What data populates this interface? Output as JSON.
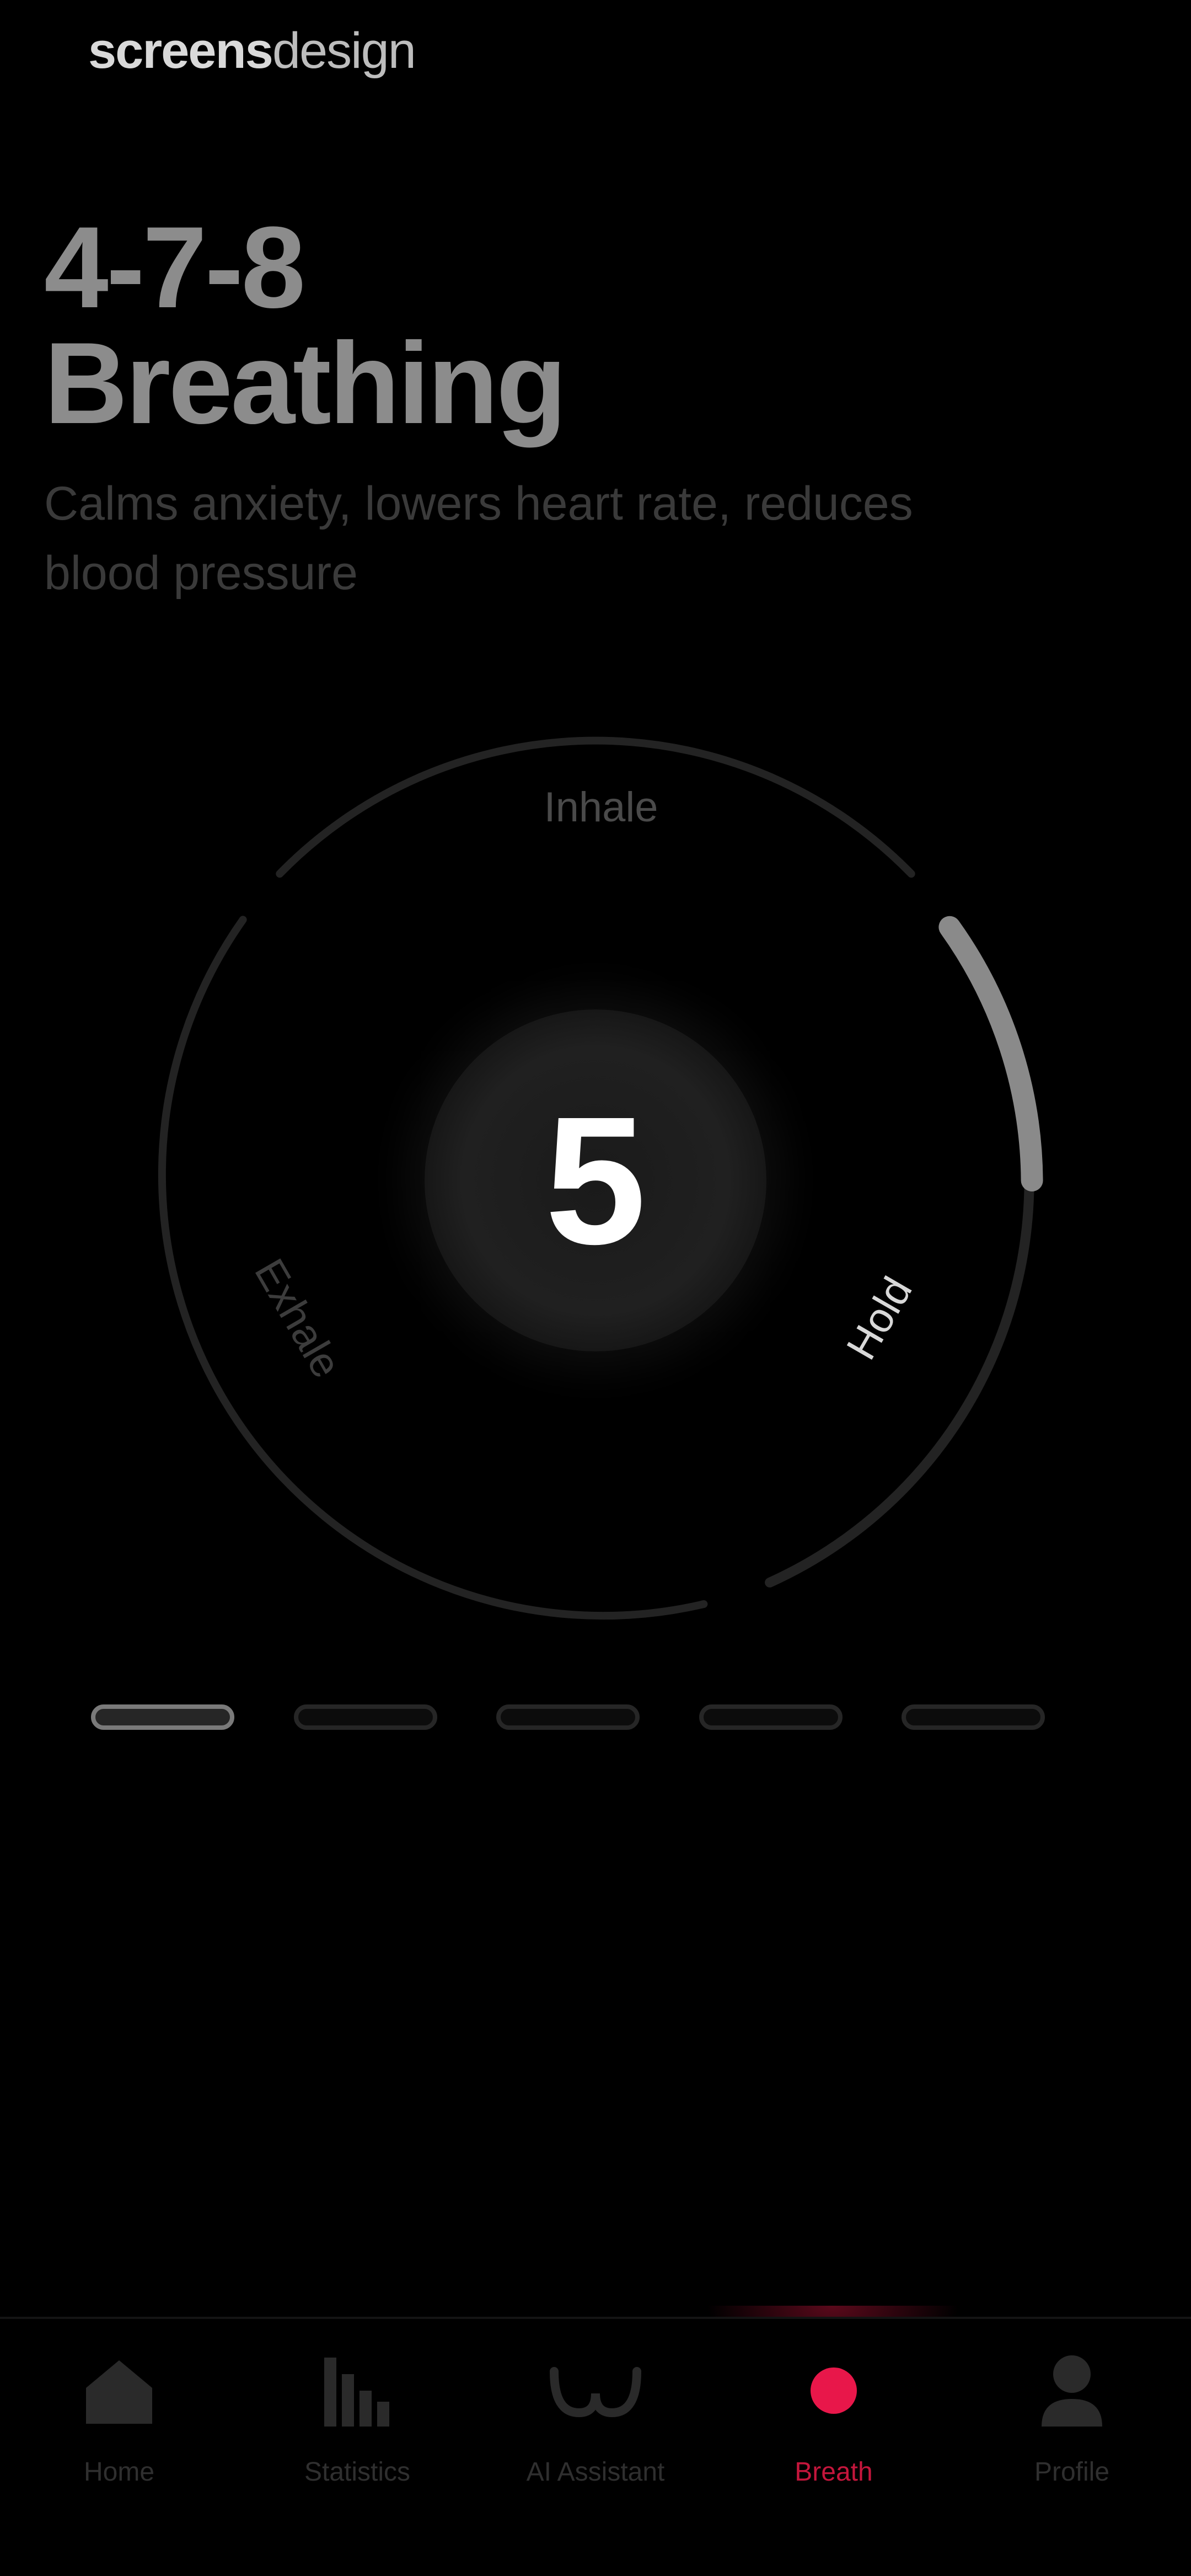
{
  "watermark": {
    "bold": "screens",
    "light": "design"
  },
  "header": {
    "title_line1": "4-7-8",
    "title_line2": "Breathing",
    "subtitle": "Calms anxiety, lowers heart rate, reduces blood pressure"
  },
  "breath_ring": {
    "phases": {
      "inhale": "Inhale",
      "hold": "Hold",
      "exhale": "Exhale"
    },
    "count": "5",
    "current_phase": "Hold"
  },
  "pager": {
    "total": 5,
    "active_index": 0
  },
  "tabbar": {
    "tabs": [
      {
        "label": "Home",
        "icon": "home-icon",
        "active": false
      },
      {
        "label": "Statistics",
        "icon": "bar-chart-icon",
        "active": false
      },
      {
        "label": "AI Assistant",
        "icon": "assistant-icon",
        "active": false
      },
      {
        "label": "Breath",
        "icon": "breath-dot-icon",
        "active": true
      },
      {
        "label": "Profile",
        "icon": "profile-icon",
        "active": false
      }
    ]
  },
  "colors": {
    "background": "#000000",
    "accent": "#e8174a",
    "progress": "#8a8a8a",
    "track": "#232323"
  }
}
